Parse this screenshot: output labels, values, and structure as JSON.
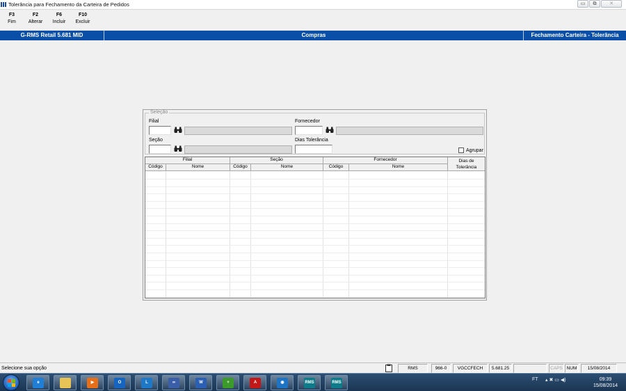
{
  "window": {
    "title": "Tolerância para Fechamento da Carteira de Pedidos",
    "buttons": {
      "minimize": "▭",
      "restore": "⧉",
      "close": "✕"
    }
  },
  "fkeys": [
    {
      "key": "F3",
      "label": "Fim"
    },
    {
      "key": "F2",
      "label": "Alterar"
    },
    {
      "key": "F6",
      "label": "Incluir"
    },
    {
      "key": "F10",
      "label": "Excluir"
    }
  ],
  "banner": {
    "left": "G-RMS Retail 5.681 MID",
    "center": "Compras",
    "right": "Fechamento Carteira - Tolerância",
    "color": "#0a4fa7"
  },
  "selection": {
    "legend": "Seleção",
    "filial_label": "Filial",
    "secao_label": "Seção",
    "fornecedor_label": "Fornecedor",
    "dias_label": "Dias Tolerância",
    "agrupar_label": "Agrupar",
    "agrupar_checked": false
  },
  "grid": {
    "groups": [
      "Filial",
      "Seção",
      "Fornecedor"
    ],
    "columns": [
      "Código",
      "Nome",
      "Código",
      "Nome",
      "Código",
      "Nome"
    ],
    "last_column": "Dias de Tolerância",
    "rows": []
  },
  "status": {
    "message": "Selecione sua opção",
    "cells": [
      "RMS",
      "966-0",
      "VGCCFECH",
      "5.681.25",
      "",
      "CAPS",
      "NUM",
      "15/08/2014"
    ]
  },
  "taskbar": {
    "apps": [
      {
        "icon": "internet-explorer-icon",
        "text": "e",
        "color": "#1f7fd6"
      },
      {
        "icon": "folder-icon",
        "text": "",
        "color": "#e7c357"
      },
      {
        "icon": "media-player-icon",
        "text": "▶",
        "color": "#e86f1a"
      },
      {
        "icon": "outlook-icon",
        "text": "O",
        "color": "#1464c0"
      },
      {
        "icon": "lync-icon",
        "text": "L",
        "color": "#1e78c8"
      },
      {
        "icon": "link-icon",
        "text": "∞",
        "color": "#3a5fa8"
      },
      {
        "icon": "word-icon",
        "text": "W",
        "color": "#2b5fb4"
      },
      {
        "icon": "database-add-icon",
        "text": "+",
        "color": "#3b9a2a"
      },
      {
        "icon": "acrobat-icon",
        "text": "A",
        "color": "#c41818"
      },
      {
        "icon": "globe-icon",
        "text": "◉",
        "color": "#1d74c4"
      },
      {
        "icon": "rms-icon",
        "text": "RMS",
        "color": "#0d7c8a"
      },
      {
        "icon": "rms-icon",
        "text": "RMS",
        "color": "#0d7c8a"
      }
    ],
    "tray_lang": "FT",
    "tray_icons": "▴  ✖  ▭  ◀)",
    "time": "09:39",
    "date": "15/08/2014"
  }
}
